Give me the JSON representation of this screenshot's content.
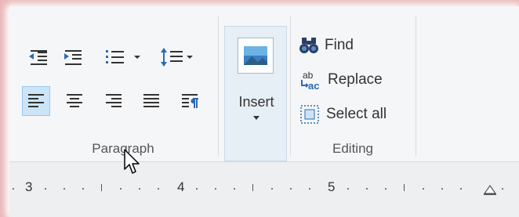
{
  "ribbon": {
    "paragraph": {
      "label": "Paragraph",
      "icons": [
        "decrease-indent-icon",
        "increase-indent-icon",
        "bullets-icon",
        "line-spacing-icon",
        "align-left-icon",
        "align-center-icon",
        "align-right-icon",
        "justify-icon",
        "paragraph-settings-icon"
      ],
      "selected_alignment": "align-left"
    },
    "insert": {
      "label": "Insert",
      "icon": "picture-icon"
    },
    "editing": {
      "label": "Editing",
      "find_label": "Find",
      "replace_label": "Replace",
      "select_all_label": "Select all"
    }
  },
  "ruler": {
    "numbers": [
      "3",
      "4",
      "5"
    ]
  },
  "colors": {
    "selection_fill": "#cce4f7",
    "selection_border": "#99c7ee",
    "accent_blue": "#1a70c8"
  }
}
